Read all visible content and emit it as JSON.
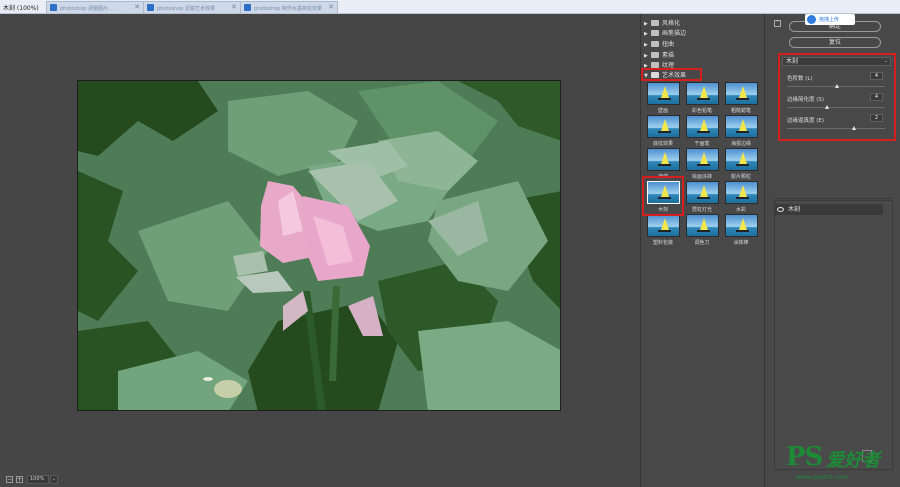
{
  "window": {
    "title": "木刻 (100%)",
    "tabs": [
      {
        "label": "photoshop 调整图片..."
      },
      {
        "label": "photoshop 滤镜艺术效果"
      },
      {
        "label": "photoshop 制作水墨荷花效果"
      }
    ],
    "close_glyph": "✕"
  },
  "canvas": {
    "zoom_value": "100%",
    "zoom_out_glyph": "−",
    "zoom_in_glyph": "+",
    "zoom_dropdown_glyph": "⌄"
  },
  "gallery": {
    "categories": [
      {
        "label": "风格化",
        "open": false
      },
      {
        "label": "画笔描边",
        "open": false
      },
      {
        "label": "扭曲",
        "open": false
      },
      {
        "label": "素描",
        "open": false
      },
      {
        "label": "纹理",
        "open": false
      },
      {
        "label": "艺术效果",
        "open": true
      }
    ],
    "collapsed_arrow": "▶",
    "open_arrow": "▼",
    "filters": [
      {
        "label": "壁画"
      },
      {
        "label": "彩色铅笔"
      },
      {
        "label": "粗糙蜡笔"
      },
      {
        "label": "底纹效果"
      },
      {
        "label": "干画笔"
      },
      {
        "label": "海报边缘"
      },
      {
        "label": "海绵"
      },
      {
        "label": "绘画涂抹"
      },
      {
        "label": "胶片颗粒"
      },
      {
        "label": "木刻",
        "selected": true
      },
      {
        "label": "霓虹灯光"
      },
      {
        "label": "水彩"
      },
      {
        "label": "塑料包装"
      },
      {
        "label": "调色刀"
      },
      {
        "label": "涂抹棒"
      }
    ]
  },
  "settings": {
    "collapse_glyph": "⌃",
    "ok_label": "确定",
    "reset_label": "复位",
    "upload_label": "拖拽上传",
    "filter_select": "木刻",
    "dropdown_glyph": "⌄",
    "params": [
      {
        "label": "色阶数 (L)",
        "value": "4",
        "level": 0.5
      },
      {
        "label": "边缘简化度 (S)",
        "value": "4",
        "level": 0.4
      },
      {
        "label": "边缘逼真度 (E)",
        "value": "2",
        "level": 0.67
      }
    ],
    "layer_name": "木刻"
  },
  "watermark": {
    "brand": "PS",
    "cn": "爱好者",
    "url": "www.psahz.com"
  },
  "colors": {
    "highlight": "#d41f1f",
    "panel_bg": "#484848",
    "canvas_bg": "#464646"
  }
}
